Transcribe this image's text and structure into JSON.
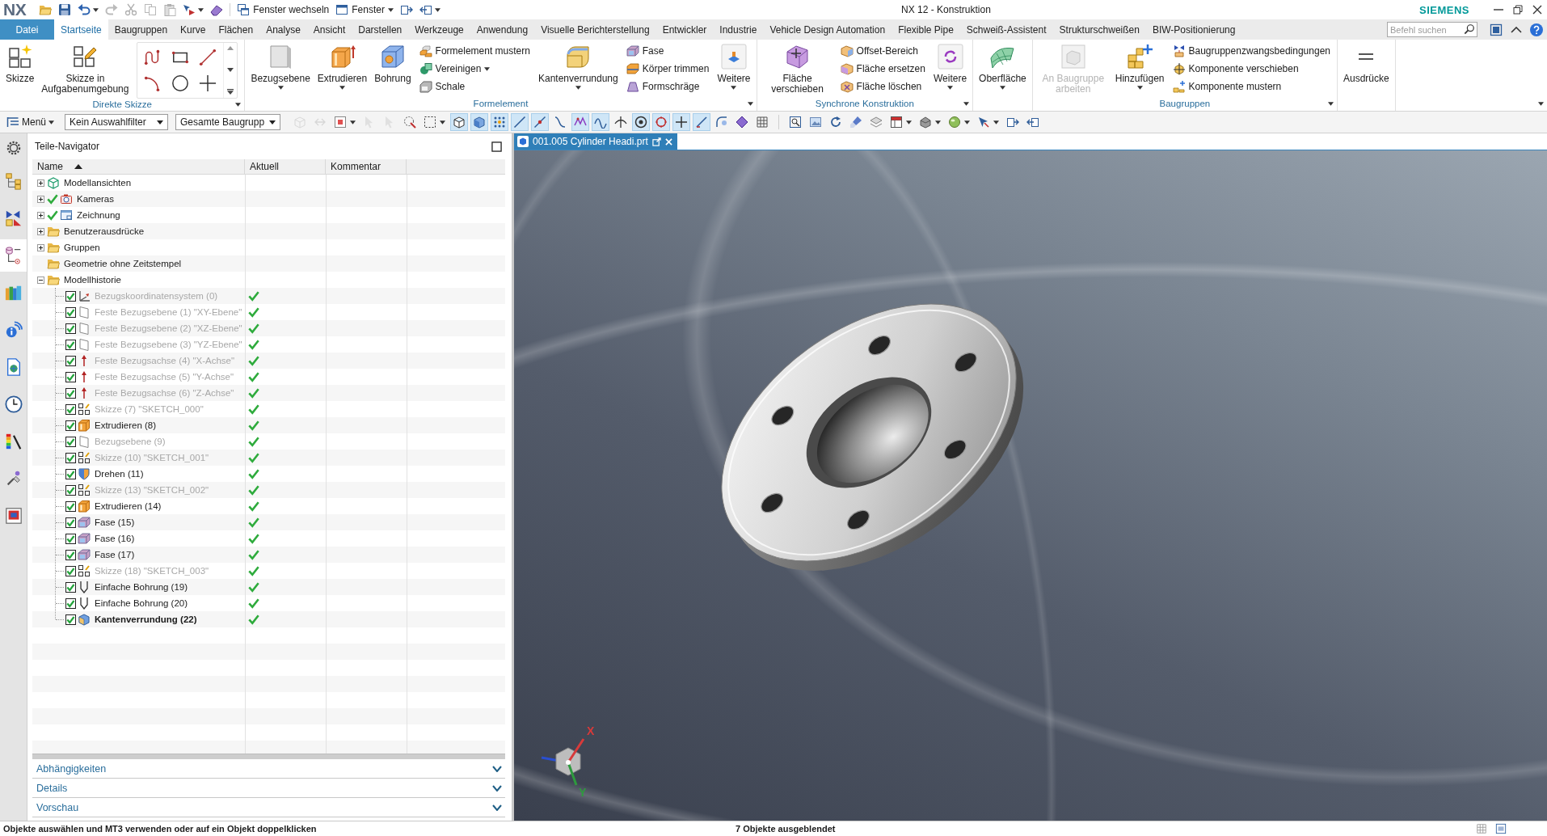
{
  "title_bar": {
    "logo": "NX",
    "commands": [
      {
        "label": "Fenster wechseln",
        "dropdown": false
      },
      {
        "label": "Fenster",
        "dropdown": true
      }
    ],
    "title": "NX 12 - Konstruktion",
    "brand": "SIEMENS"
  },
  "menu_tabs": [
    {
      "label": "Datei",
      "kind": "file",
      "selected": false
    },
    {
      "label": "Startseite",
      "kind": "tab",
      "selected": true
    },
    {
      "label": "Baugruppen",
      "kind": "tab",
      "selected": false
    },
    {
      "label": "Kurve",
      "kind": "tab",
      "selected": false
    },
    {
      "label": "Flächen",
      "kind": "tab",
      "selected": false
    },
    {
      "label": "Analyse",
      "kind": "tab",
      "selected": false
    },
    {
      "label": "Ansicht",
      "kind": "tab",
      "selected": false
    },
    {
      "label": "Darstellen",
      "kind": "tab",
      "selected": false
    },
    {
      "label": "Werkzeuge",
      "kind": "tab",
      "selected": false
    },
    {
      "label": "Anwendung",
      "kind": "tab",
      "selected": false
    },
    {
      "label": "Visuelle Berichterstellung",
      "kind": "tab",
      "selected": false
    },
    {
      "label": "Entwickler",
      "kind": "tab",
      "selected": false
    },
    {
      "label": "Industrie",
      "kind": "tab",
      "selected": false
    },
    {
      "label": "Vehicle Design Automation",
      "kind": "tab",
      "selected": false
    },
    {
      "label": "Flexible Pipe",
      "kind": "tab",
      "selected": false
    },
    {
      "label": "Schweiß-Assistent",
      "kind": "tab",
      "selected": false
    },
    {
      "label": "Strukturschweißen",
      "kind": "tab",
      "selected": false
    },
    {
      "label": "BIW-Positionierung",
      "kind": "tab",
      "selected": false
    }
  ],
  "command_search": {
    "placeholder": "Befehl suchen"
  },
  "ribbon": [
    {
      "label": "Direkte Skizze",
      "overflow": true,
      "items": [
        {
          "kind": "large",
          "label": "Skizze",
          "dropdown": false,
          "disabled": false
        },
        {
          "kind": "large",
          "label": "Skizze in Aufgabenumgebung",
          "dropdown": false,
          "disabled": false
        },
        {
          "kind": "gallery"
        }
      ]
    },
    {
      "label": "Formelement",
      "overflow": true,
      "items": [
        {
          "kind": "large",
          "label": "Bezugsebene",
          "dropdown": true,
          "disabled": false
        },
        {
          "kind": "large",
          "label": "Extrudieren",
          "dropdown": true,
          "disabled": false
        },
        {
          "kind": "large",
          "label": "Bohrung",
          "dropdown": false,
          "disabled": false
        },
        {
          "kind": "stack",
          "commands": [
            {
              "label": "Formelement mustern",
              "dropdown": false
            },
            {
              "label": "Vereinigen",
              "dropdown": true
            },
            {
              "label": "Schale",
              "dropdown": false
            }
          ]
        },
        {
          "kind": "large",
          "label": "Kantenverrundung",
          "dropdown": true,
          "disabled": false
        },
        {
          "kind": "stack",
          "commands": [
            {
              "label": "Fase",
              "dropdown": false
            },
            {
              "label": "Körper trimmen",
              "dropdown": false
            },
            {
              "label": "Formschräge",
              "dropdown": false
            }
          ]
        },
        {
          "kind": "large",
          "label": "Weitere",
          "dropdown": true,
          "disabled": false
        }
      ]
    },
    {
      "label": "Synchrone Konstruktion",
      "overflow": true,
      "items": [
        {
          "kind": "large",
          "label": "Fläche verschieben",
          "dropdown": false,
          "disabled": false
        },
        {
          "kind": "stack",
          "commands": [
            {
              "label": "Offset-Bereich",
              "dropdown": false
            },
            {
              "label": "Fläche ersetzen",
              "dropdown": false
            },
            {
              "label": "Fläche löschen",
              "dropdown": false
            }
          ]
        },
        {
          "kind": "large",
          "label": "Weitere",
          "dropdown": true,
          "disabled": false
        }
      ]
    },
    {
      "overflow": false,
      "items": [
        {
          "kind": "large",
          "label": "Oberfläche",
          "dropdown": true,
          "disabled": false
        }
      ]
    },
    {
      "label": "Baugruppen",
      "overflow": true,
      "items": [
        {
          "kind": "large",
          "label": "An Baugruppe arbeiten",
          "dropdown": false,
          "disabled": true
        },
        {
          "kind": "large",
          "label": "Hinzufügen",
          "dropdown": true,
          "disabled": false
        },
        {
          "kind": "stack",
          "commands": [
            {
              "label": "Baugruppenzwangsbedingungen",
              "dropdown": false
            },
            {
              "label": "Komponente verschieben",
              "dropdown": false
            },
            {
              "label": "Komponente mustern",
              "dropdown": false
            }
          ]
        }
      ]
    },
    {
      "overflow": false,
      "items": [
        {
          "kind": "large",
          "label": "Ausdrücke",
          "dropdown": false,
          "disabled": false
        }
      ]
    }
  ],
  "selection_bar": {
    "menu": "Menü",
    "filters": [
      {
        "value": "Kein Auswahlfilter"
      },
      {
        "value": "Gesamte Baugrupp"
      }
    ],
    "tools": [
      {
        "on": false,
        "dropdown": false,
        "disabled": true
      },
      {
        "on": false,
        "dropdown": false,
        "disabled": true
      },
      {
        "on": false,
        "dropdown": true,
        "disabled": false
      },
      {
        "on": false,
        "dropdown": false,
        "disabled": true
      },
      {
        "on": false,
        "dropdown": false,
        "disabled": true
      },
      {
        "on": false,
        "dropdown": false,
        "disabled": false
      },
      {
        "on": false,
        "dropdown": true,
        "disabled": false
      },
      {
        "on": true,
        "dropdown": false,
        "disabled": false
      },
      {
        "on": true,
        "dropdown": false,
        "disabled": false
      },
      {
        "on": true,
        "dropdown": false,
        "disabled": false
      },
      {
        "on": true,
        "dropdown": false,
        "disabled": false
      },
      {
        "on": true,
        "dropdown": false,
        "disabled": false
      },
      {
        "on": false,
        "dropdown": false,
        "disabled": false
      },
      {
        "on": true,
        "dropdown": false,
        "disabled": false
      },
      {
        "on": true,
        "dropdown": false,
        "disabled": false
      },
      {
        "on": false,
        "dropdown": false,
        "disabled": false
      },
      {
        "on": true,
        "dropdown": false,
        "disabled": false
      },
      {
        "on": true,
        "dropdown": false,
        "disabled": false
      },
      {
        "on": true,
        "dropdown": false,
        "disabled": false
      },
      {
        "on": true,
        "dropdown": false,
        "disabled": false
      },
      {
        "on": false,
        "dropdown": false,
        "disabled": false
      },
      {
        "on": false,
        "dropdown": false,
        "disabled": false
      },
      {
        "on": false,
        "dropdown": false,
        "disabled": false
      },
      {
        "on": false,
        "dropdown": false,
        "disabled": false
      },
      {
        "on": false,
        "dropdown": false,
        "disabled": false
      },
      {
        "on": false,
        "dropdown": false,
        "disabled": false
      },
      {
        "on": false,
        "dropdown": false,
        "disabled": false
      },
      {
        "on": false,
        "dropdown": false,
        "disabled": false
      },
      {
        "on": false,
        "dropdown": true,
        "disabled": false
      },
      {
        "on": false,
        "dropdown": true,
        "disabled": false
      },
      {
        "on": false,
        "dropdown": true,
        "disabled": false
      },
      {
        "on": false,
        "dropdown": true,
        "disabled": false
      },
      {
        "on": false,
        "dropdown": false,
        "disabled": false
      },
      {
        "on": false,
        "dropdown": false,
        "disabled": false
      }
    ]
  },
  "resource_bar": [
    {
      "selected": false
    },
    {
      "selected": false
    },
    {
      "selected": false
    },
    {
      "selected": true
    },
    {
      "selected": false
    },
    {
      "selected": false
    },
    {
      "selected": false
    },
    {
      "selected": false
    },
    {
      "selected": false
    },
    {
      "selected": false
    },
    {
      "selected": false
    }
  ],
  "navigator": {
    "title": "Teile-Navigator",
    "columns": [
      {
        "label": "Name",
        "sorted": true
      },
      {
        "label": "Aktuell",
        "sorted": false
      },
      {
        "label": "Kommentar",
        "sorted": false
      }
    ],
    "tree": [
      {
        "label": "Modellansichten",
        "kind": "views",
        "expanded": false,
        "visible": false
      },
      {
        "label": "Kameras",
        "kind": "cameras",
        "expanded": false,
        "visible": true
      },
      {
        "label": "Zeichnung",
        "kind": "drawing",
        "expanded": false,
        "visible": true
      },
      {
        "label": "Benutzerausdrücke",
        "kind": "folder",
        "expanded": false,
        "visible": false
      },
      {
        "label": "Gruppen",
        "kind": "folder",
        "expanded": false,
        "visible": false
      },
      {
        "label": "Geometrie ohne Zeitstempel",
        "kind": "folder",
        "visible": false
      },
      {
        "label": "Modellhistorie",
        "kind": "folder",
        "expanded": true,
        "visible": false,
        "children": [
          {
            "label": "Bezugskoordinatensystem (0)",
            "kind": "csys",
            "checked": true,
            "dimmed": true,
            "current": false,
            "up_to_date": true
          },
          {
            "label": "Feste Bezugsebene (1) \"XY-Ebene\"",
            "kind": "plane",
            "checked": true,
            "dimmed": true,
            "current": false,
            "up_to_date": true
          },
          {
            "label": "Feste Bezugsebene (2) \"XZ-Ebene\"",
            "kind": "plane",
            "checked": true,
            "dimmed": true,
            "current": false,
            "up_to_date": true
          },
          {
            "label": "Feste Bezugsebene (3) \"YZ-Ebene\"",
            "kind": "plane",
            "checked": true,
            "dimmed": true,
            "current": false,
            "up_to_date": true
          },
          {
            "label": "Feste Bezugsachse (4) \"X-Achse\"",
            "kind": "axis",
            "checked": true,
            "dimmed": true,
            "current": false,
            "up_to_date": true
          },
          {
            "label": "Feste Bezugsachse (5) \"Y-Achse\"",
            "kind": "axis",
            "checked": true,
            "dimmed": true,
            "current": false,
            "up_to_date": true
          },
          {
            "label": "Feste Bezugsachse (6) \"Z-Achse\"",
            "kind": "axis",
            "checked": true,
            "dimmed": true,
            "current": false,
            "up_to_date": true
          },
          {
            "label": "Skizze (7) \"SKETCH_000\"",
            "kind": "sketch",
            "checked": true,
            "dimmed": true,
            "current": false,
            "up_to_date": true
          },
          {
            "label": "Extrudieren (8)",
            "kind": "extrude",
            "checked": true,
            "dimmed": false,
            "current": false,
            "up_to_date": true
          },
          {
            "label": "Bezugsebene (9)",
            "kind": "plane",
            "checked": true,
            "dimmed": true,
            "current": false,
            "up_to_date": true
          },
          {
            "label": "Skizze (10) \"SKETCH_001\"",
            "kind": "sketch",
            "checked": true,
            "dimmed": true,
            "current": false,
            "up_to_date": true
          },
          {
            "label": "Drehen (11)",
            "kind": "revolve",
            "checked": true,
            "dimmed": false,
            "current": false,
            "up_to_date": true
          },
          {
            "label": "Skizze (13) \"SKETCH_002\"",
            "kind": "sketch",
            "checked": true,
            "dimmed": true,
            "current": false,
            "up_to_date": true
          },
          {
            "label": "Extrudieren (14)",
            "kind": "extrude",
            "checked": true,
            "dimmed": false,
            "current": false,
            "up_to_date": true
          },
          {
            "label": "Fase (15)",
            "kind": "chamfer",
            "checked": true,
            "dimmed": false,
            "current": false,
            "up_to_date": true
          },
          {
            "label": "Fase (16)",
            "kind": "chamfer",
            "checked": true,
            "dimmed": false,
            "current": false,
            "up_to_date": true
          },
          {
            "label": "Fase (17)",
            "kind": "chamfer",
            "checked": true,
            "dimmed": false,
            "current": false,
            "up_to_date": true
          },
          {
            "label": "Skizze (18) \"SKETCH_003\"",
            "kind": "sketch",
            "checked": true,
            "dimmed": true,
            "current": false,
            "up_to_date": true
          },
          {
            "label": "Einfache Bohrung (19)",
            "kind": "hole",
            "checked": true,
            "dimmed": false,
            "current": false,
            "up_to_date": true
          },
          {
            "label": "Einfache Bohrung (20)",
            "kind": "hole",
            "checked": true,
            "dimmed": false,
            "current": false,
            "up_to_date": true
          },
          {
            "label": "Kantenverrundung (22)",
            "kind": "blend",
            "checked": true,
            "dimmed": false,
            "current": true,
            "up_to_date": true
          }
        ]
      }
    ],
    "panels": [
      {
        "label": "Abhängigkeiten",
        "expanded": false
      },
      {
        "label": "Details",
        "expanded": false
      },
      {
        "label": "Vorschau",
        "expanded": false
      }
    ]
  },
  "viewport": {
    "tabs": [
      {
        "label": "001.005 Cylinder Headi.prt",
        "selected": true
      }
    ],
    "triad": [
      {
        "label": "X",
        "color": "#d83a3a"
      },
      {
        "label": "Y",
        "color": "#2e9a3e"
      }
    ]
  },
  "status_bar": {
    "message": "Objekte auswählen und MT3 verwenden oder auf ein Objekt doppelklicken",
    "info": "7 Objekte ausgeblendet"
  }
}
